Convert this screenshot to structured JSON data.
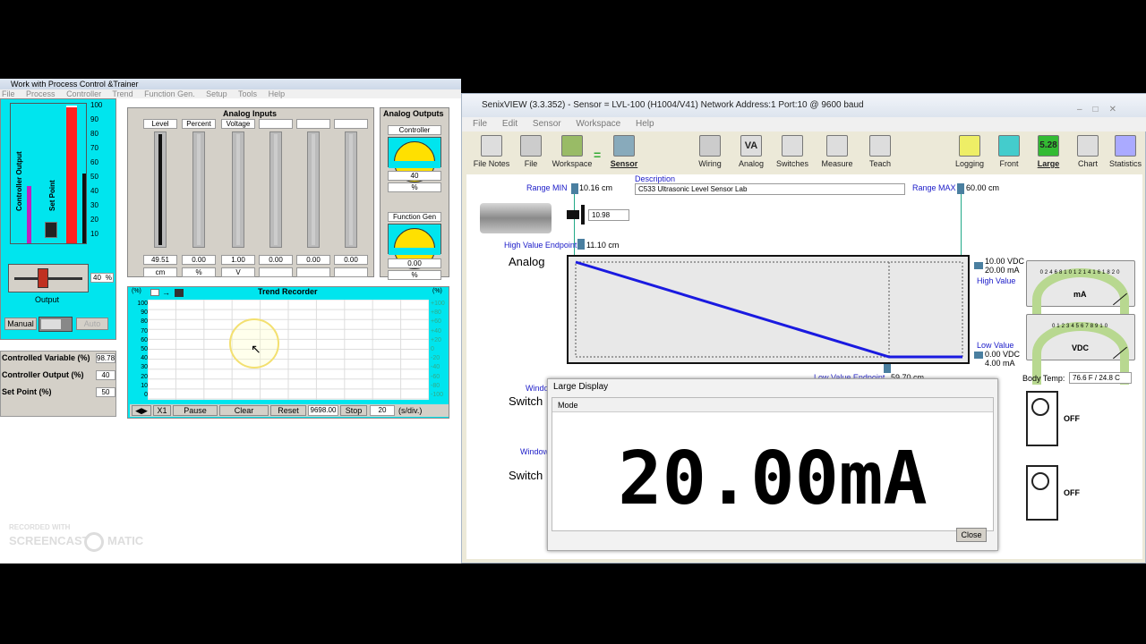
{
  "left_window": {
    "title": "Work with Process Control &Trainer",
    "menu": [
      "File",
      "Process",
      "Controller",
      "Trend",
      "Function Gen.",
      "Setup",
      "Tools",
      "Help"
    ],
    "controller_output_label": "Controller Output",
    "set_point_label": "Set Point",
    "left_scale": [
      "100",
      "90",
      "80",
      "70",
      "60",
      "50",
      "40",
      "30",
      "20",
      "10",
      "0"
    ],
    "output_value": "40",
    "output_unit": "%",
    "output_label": "Output",
    "manual_label": "Manual",
    "auto_label": "Auto",
    "analog_inputs": {
      "title": "Analog Inputs",
      "headers": [
        "Level",
        "Percent",
        "Voltage",
        "",
        "",
        ""
      ],
      "values": [
        "49.51",
        "0.00",
        "1.00",
        "0.00",
        "0.00",
        "0.00"
      ],
      "units": [
        "cm",
        "%",
        "V",
        "",
        "",
        ""
      ]
    },
    "analog_outputs": {
      "title": "Analog Outputs",
      "controller": "Controller",
      "controller_value": "40",
      "controller_unit": "%",
      "function_gen": "Function Gen",
      "function_value": "0.00",
      "function_unit": "%"
    },
    "trend": {
      "title": "Trend Recorder",
      "pct_left": "(%)",
      "pct_right": "(%)",
      "left_scale": [
        "100",
        "90",
        "80",
        "70",
        "60",
        "50",
        "40",
        "30",
        "20",
        "10",
        "0"
      ],
      "right_scale": [
        "+100",
        "+80",
        "+60",
        "+40",
        "+20",
        "0",
        "-20",
        "-40",
        "-60",
        "-80",
        "-100"
      ],
      "buttons": {
        "x1": "X1",
        "pause": "Pause",
        "clear": "Clear",
        "reset": "Reset",
        "time": "9698.00",
        "stop": "Stop",
        "div": "20",
        "div_unit": "(s/div.)"
      }
    },
    "stats": [
      {
        "label": "Controlled Variable (%)",
        "value": "98.78"
      },
      {
        "label": "Controller Output (%)",
        "value": "40"
      },
      {
        "label": "Set Point (%)",
        "value": "50"
      }
    ]
  },
  "right_window": {
    "title": "SenixVIEW (3.3.352) - Sensor = LVL-100 (H1004/V41)  Network Address:1  Port:10 @ 9600 baud",
    "menu": [
      "File",
      "Edit",
      "Sensor",
      "Workspace",
      "Help"
    ],
    "toolbar": [
      "File Notes",
      "File",
      "Workspace",
      "Sensor",
      "Wiring",
      "Analog",
      "Switches",
      "Measure",
      "Teach",
      "Logging",
      "Front",
      "Large",
      "Chart",
      "Statistics"
    ],
    "large_icon_text": "5.28",
    "analog_icon_text": "VA",
    "range_min": "Range MIN",
    "range_min_val": "10.16 cm",
    "range_max": "Range MAX",
    "range_max_val": "60.00 cm",
    "description_label": "Description",
    "description": "C533 Ultrasonic Level Sensor Lab",
    "reading": "10.98",
    "high_endpoint": "High Value Endpoint",
    "high_endpoint_val": "11.10 cm",
    "analog_label": "Analog",
    "hv": {
      "vdc": "10.00 VDC",
      "ma": "20.00 mA",
      "label": "High Value"
    },
    "lv": {
      "label": "Low Value",
      "vdc": "0.00 VDC",
      "ma": "4.00 mA"
    },
    "lv_endpoint": "Low Value Endpoint",
    "lv_endpoint_val": "59.70 cm",
    "window1": "Window",
    "switch1": "Switch",
    "window2": "Window",
    "switch2": "Switch",
    "meter_ma": "mA",
    "meter_vdc": "VDC",
    "ma_scale": [
      "0",
      "2",
      "4",
      "6",
      "8",
      "10",
      "12",
      "14",
      "16",
      "18",
      "20"
    ],
    "vdc_scale": [
      "0",
      "1",
      "2",
      "3",
      "4",
      "5",
      "6",
      "7",
      "8",
      "9",
      "10"
    ],
    "body_temp": "Body Temp:",
    "body_temp_val": "76.6 F / 24.8 C",
    "off1": "OFF",
    "off2": "OFF"
  },
  "large_display": {
    "title": "Large Display",
    "mode": "Mode",
    "value": "20.00mA",
    "close": "Close"
  },
  "watermark": {
    "line1": "RECORDED WITH",
    "line2": "SCREENCAST",
    "line3": "MATIC"
  }
}
